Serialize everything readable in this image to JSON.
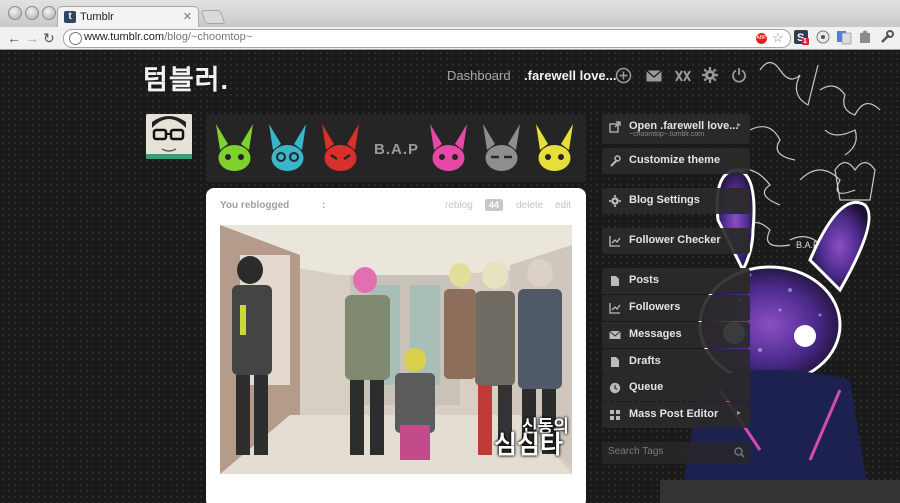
{
  "browser": {
    "tab_title": "Tumblr",
    "tab_close": "✕",
    "back": "←",
    "forward": "→",
    "reload": "↻",
    "url_main": "www.tumblr.com",
    "url_path": "/blog/~choomtop~",
    "abp": "ABP",
    "star": "☆",
    "ext_badge": "1"
  },
  "header": {
    "logo": "텀블러.",
    "nav_dashboard": "Dashboard",
    "nav_blog": ".farewell love..."
  },
  "banner": {
    "group_name": "B.A.P",
    "bunny_colors": [
      "#7fd12e",
      "#3ab6c8",
      "#d8302a",
      "#e548a6",
      "#8e8e8e",
      "#e5e039"
    ]
  },
  "post": {
    "label": "You reblogged",
    "colon": ":",
    "reblog": "reblog",
    "notes": "44",
    "delete": "delete",
    "edit": "edit",
    "photo_text_small": "신동의",
    "photo_text_large": "심심타"
  },
  "sidebar": {
    "open": {
      "label": "Open .farewell love...",
      "sub": "~choomtop~.tumblr.com",
      "caret": "▸"
    },
    "customize": {
      "label": "Customize theme"
    },
    "blog_settings": {
      "label": "Blog Settings"
    },
    "follower_checker": {
      "label": "Follower Checker"
    },
    "posts": {
      "label": "Posts"
    },
    "followers": {
      "label": "Followers"
    },
    "messages": {
      "label": "Messages"
    },
    "drafts": {
      "label": "Drafts"
    },
    "queue": {
      "label": "Queue"
    },
    "mass_post_editor": {
      "label": "Mass Post Editor",
      "caret": "▸"
    },
    "search_placeholder": "Search Tags"
  },
  "decoration": {
    "signature_caption": "B.A.P"
  }
}
